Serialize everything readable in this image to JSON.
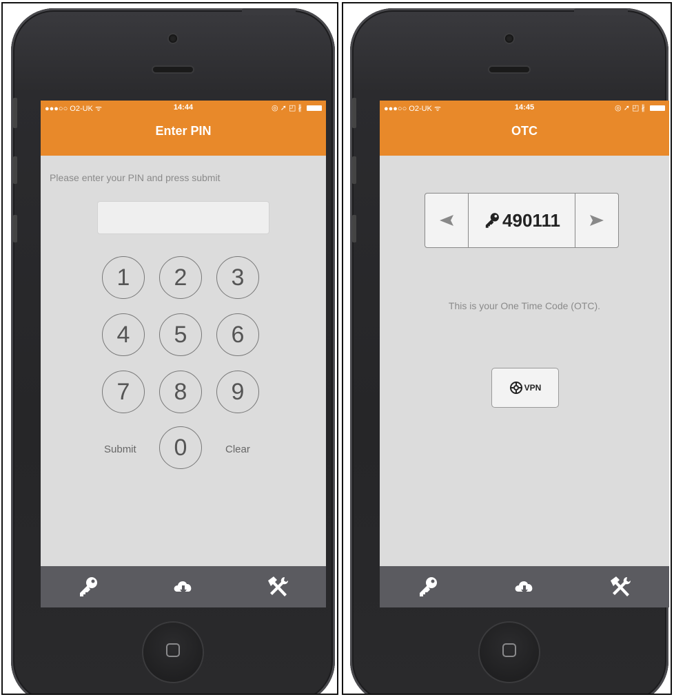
{
  "left_screen": {
    "status": {
      "carrier": "●●●○○ O2-UK ᯤ",
      "time": "14:44",
      "icons": "◎ ➚ ◰ ∦"
    },
    "title": "Enter PIN",
    "prompt": "Please enter your PIN and press submit",
    "pin_value": "",
    "keys": [
      "1",
      "2",
      "3",
      "4",
      "5",
      "6",
      "7",
      "8",
      "9",
      "0"
    ],
    "submit_label": "Submit",
    "clear_label": "Clear"
  },
  "right_screen": {
    "status": {
      "carrier": "●●●○○ O2-UK ᯤ",
      "time": "14:45",
      "icons": "◎ ➚ ◰ ∦"
    },
    "title": "OTC",
    "otc_code": "490111",
    "description": "This is your One Time Code (OTC).",
    "vpn_label": "VPN"
  },
  "tabbar": {
    "icons": [
      "key-icon",
      "cloud-download-icon",
      "tools-icon"
    ]
  },
  "colors": {
    "accent": "#e8892a",
    "screen_bg": "#dcdcdc",
    "tabbar": "#5b5b60"
  }
}
